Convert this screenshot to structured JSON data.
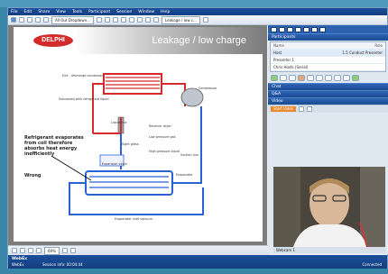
{
  "menu": [
    "File",
    "Edit",
    "Share",
    "View",
    "Tools",
    "Participant",
    "Session",
    "Window",
    "Help"
  ],
  "toolbar": {
    "doc_tab": "All Out Dropdown...",
    "view_select": "Leakage / low c..."
  },
  "slide": {
    "logo": "DELPHI",
    "title": "Leakage / low charge",
    "labels": {
      "top_left": "Exit - discharge condenser",
      "left_mid": "Subcooled with refrigerant liquid",
      "receiver": "Liquid line",
      "compressor": "Compressor",
      "dryer": "Receiver dryer",
      "hp_liquid": "High pressure liquid",
      "lp_gas": "Low pressure gas",
      "sight": "Sight glass",
      "evap": "Evaporator",
      "expansion": "Expansion valve",
      "suction": "Suction line",
      "bottom": "Evaporator inlet vacuum"
    },
    "note": "Refrigerant evaporates from coil therefore absorbs heat energy inefficiently",
    "note_bottom": "Wrong"
  },
  "bottom_bar": {
    "zoom": "69%"
  },
  "side": {
    "participants_title": "Participants",
    "participants": [
      {
        "name": "Name",
        "role": "Role"
      },
      {
        "name": "Host",
        "role": "1.5 Conduct Presenter"
      },
      {
        "name": "Presenter 1",
        "role": ""
      },
      {
        "name": "Chris Hosts (Serial)",
        "role": ""
      }
    ],
    "sections": [
      "Chat",
      "Q&A",
      "Video"
    ],
    "video_button": "Start Video",
    "video_caption": "Webcam 1"
  },
  "footer": {
    "brand_top": "WebEx",
    "brand_bottom": "WebEx",
    "session_info": "Session info: 00:04:44",
    "connected": "Connected",
    "colors": {
      "accent": "#1c4f9a",
      "slide_title": "#ffffff",
      "logo": "#d32b2b"
    }
  }
}
